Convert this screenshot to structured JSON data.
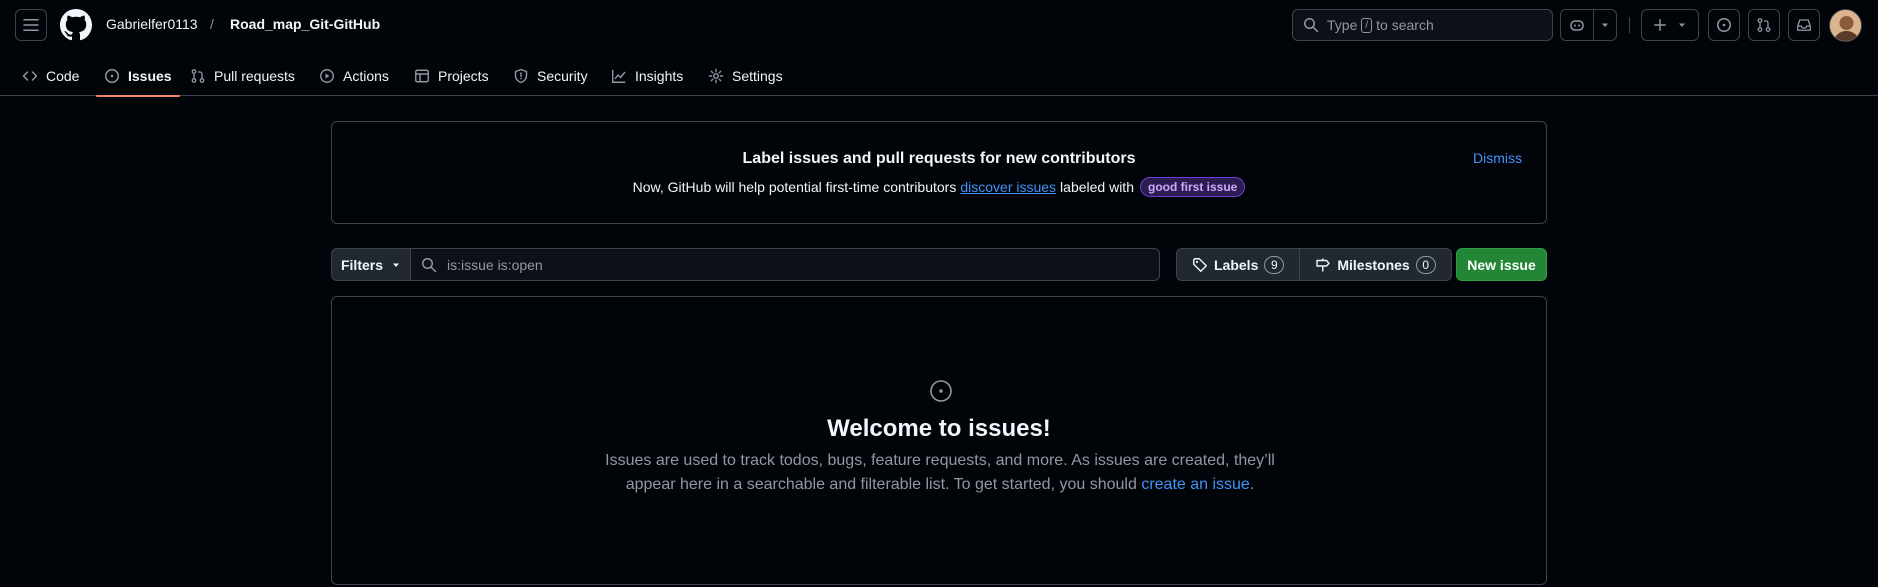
{
  "header": {
    "owner": "Gabrielfer0113",
    "separator": "/",
    "repo": "Road_map_Git-GitHub",
    "search_prefix": "Type",
    "search_key": "/",
    "search_suffix": "to search"
  },
  "tabs": [
    {
      "label": "Code",
      "icon": "code-icon"
    },
    {
      "label": "Issues",
      "icon": "issue-icon",
      "active": true
    },
    {
      "label": "Pull requests",
      "icon": "pull-request-icon"
    },
    {
      "label": "Actions",
      "icon": "play-icon"
    },
    {
      "label": "Projects",
      "icon": "table-icon"
    },
    {
      "label": "Security",
      "icon": "shield-icon"
    },
    {
      "label": "Insights",
      "icon": "graph-icon"
    },
    {
      "label": "Settings",
      "icon": "gear-icon"
    }
  ],
  "banner": {
    "title": "Label issues and pull requests for new contributors",
    "text_before": "Now, GitHub will help potential first-time contributors",
    "link": "discover issues",
    "text_after": "labeled with",
    "label_pill": "good first issue",
    "dismiss": "Dismiss"
  },
  "toolbar": {
    "filters": "Filters",
    "query": "is:issue is:open",
    "labels": "Labels",
    "labels_count": "9",
    "milestones": "Milestones",
    "milestones_count": "0",
    "new_issue": "New issue"
  },
  "blankslate": {
    "title": "Welcome to issues!",
    "text": "Issues are used to track todos, bugs, feature requests, and more. As issues are created, they’ll appear here in a searchable and filterable list. To get started, you should",
    "link": "create an issue",
    "end": "."
  },
  "colors": {
    "background": "#010409",
    "accent": "#4493f8",
    "primary_button": "#238636",
    "active_tab_underline": "#f78166"
  }
}
